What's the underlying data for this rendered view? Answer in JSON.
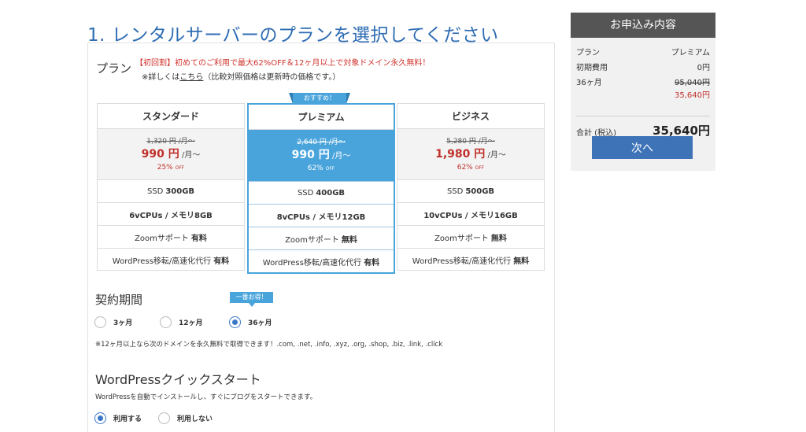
{
  "header": {
    "title": "1. レンタルサーバーのプランを選択してください"
  },
  "plan_section": {
    "label": "プラン",
    "promo": "【初回割】初めてのご利用で最大62%OFF＆12ヶ月以上で対象ドメイン永久無料！",
    "detail_prefix": "※詳しくは",
    "detail_link": "こちら",
    "detail_suffix": "（比較対照価格は更新時の価格です。）",
    "recommend_ribbon": "おすすめ！",
    "plans": [
      {
        "name": "スタンダード",
        "old_price": "1,320 円 /月〜",
        "price": "990 円",
        "price_unit": "/月〜",
        "discount": "25%",
        "discount_unit": "OFF",
        "ssd_label": "SSD",
        "ssd": "300GB",
        "cpu": "6vCPUs / メモリ8GB",
        "zoom_label": "Zoomサポート",
        "zoom": "有料",
        "wp_label": "WordPress移転/高速化代行",
        "wp": "有料"
      },
      {
        "name": "プレミアム",
        "old_price": "2,640 円 /月〜",
        "price": "990 円",
        "price_unit": "/月〜",
        "discount": "62%",
        "discount_unit": "OFF",
        "ssd_label": "SSD",
        "ssd": "400GB",
        "cpu": "8vCPUs / メモリ12GB",
        "zoom_label": "Zoomサポート",
        "zoom": "無料",
        "wp_label": "WordPress移転/高速化代行",
        "wp": "有料"
      },
      {
        "name": "ビジネス",
        "old_price": "5,280 円 /月〜",
        "price": "1,980 円",
        "price_unit": "/月〜",
        "discount": "62%",
        "discount_unit": "OFF",
        "ssd_label": "SSD",
        "ssd": "500GB",
        "cpu": "10vCPUs / メモリ16GB",
        "zoom_label": "Zoomサポート",
        "zoom": "無料",
        "wp_label": "WordPress移転/高速化代行",
        "wp": "無料"
      }
    ],
    "selected_plan": "プレミアム"
  },
  "contract": {
    "title": "契約期間",
    "badge": "一番お得！",
    "options": [
      "3ヶ月",
      "12ヶ月",
      "36ヶ月"
    ],
    "selected": "36ヶ月",
    "note": "※12ヶ月以上なら次のドメインを永久無料で取得できます！.com, .net, .info, .xyz, .org, .shop, .biz, .link, .click"
  },
  "wordpress": {
    "title": "WordPressクイックスタート",
    "description": "WordPressを自動でインストールし、すぐにブログをスタートできます。",
    "options": [
      "利用する",
      "利用しない"
    ],
    "selected": "利用する"
  },
  "summary": {
    "title": "お申込み内容",
    "plan_label": "プラン",
    "plan_value": "プレミアム",
    "setup_label": "初期費用",
    "setup_value": "0円",
    "term_label": "36ヶ月",
    "term_old": "95,040円",
    "term_new": "35,640円",
    "total_label": "合計 (税込)",
    "total_value": "35,640円",
    "next_button": "次へ"
  },
  "colors": {
    "accent_blue": "#4aa4dc",
    "title_blue": "#2f6db3",
    "price_red": "#c0302a",
    "button_blue": "#3e73b8",
    "summary_header": "#555555"
  }
}
